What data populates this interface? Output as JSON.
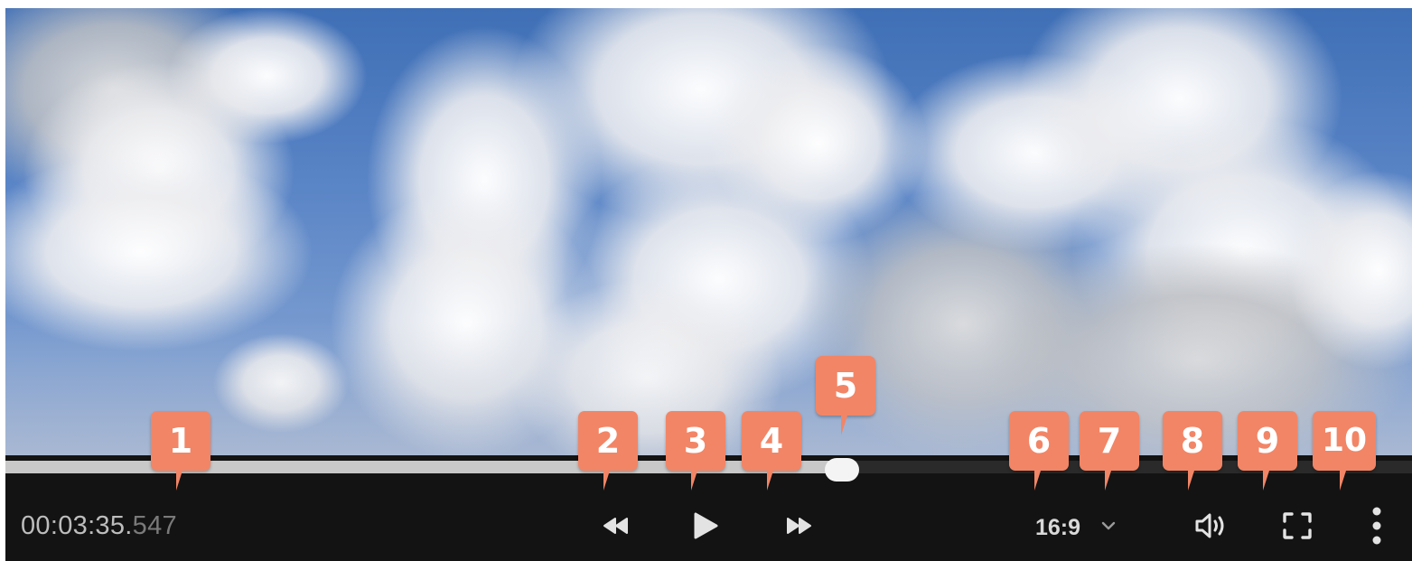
{
  "player": {
    "timecode_main": "00:03:35.",
    "timecode_ms": "547",
    "progress_fraction": 0.595,
    "aspect_ratio": "16:9"
  },
  "icons": {
    "rewind": "rewind-icon",
    "play": "play-icon",
    "fast_forward": "fast-forward-icon",
    "aspect_dropdown": "chevron-down-icon",
    "volume": "volume-icon",
    "fullscreen": "fullscreen-icon",
    "more": "more-vertical-icon"
  },
  "callouts": [
    "1",
    "2",
    "3",
    "4",
    "5",
    "6",
    "7",
    "8",
    "9",
    "10"
  ],
  "colors": {
    "callout": "#f28566",
    "control_bar": "#131313",
    "progress_played": "#c8c8c8",
    "progress_remaining": "#2a2a2a",
    "thumb": "#f4f4f4"
  }
}
